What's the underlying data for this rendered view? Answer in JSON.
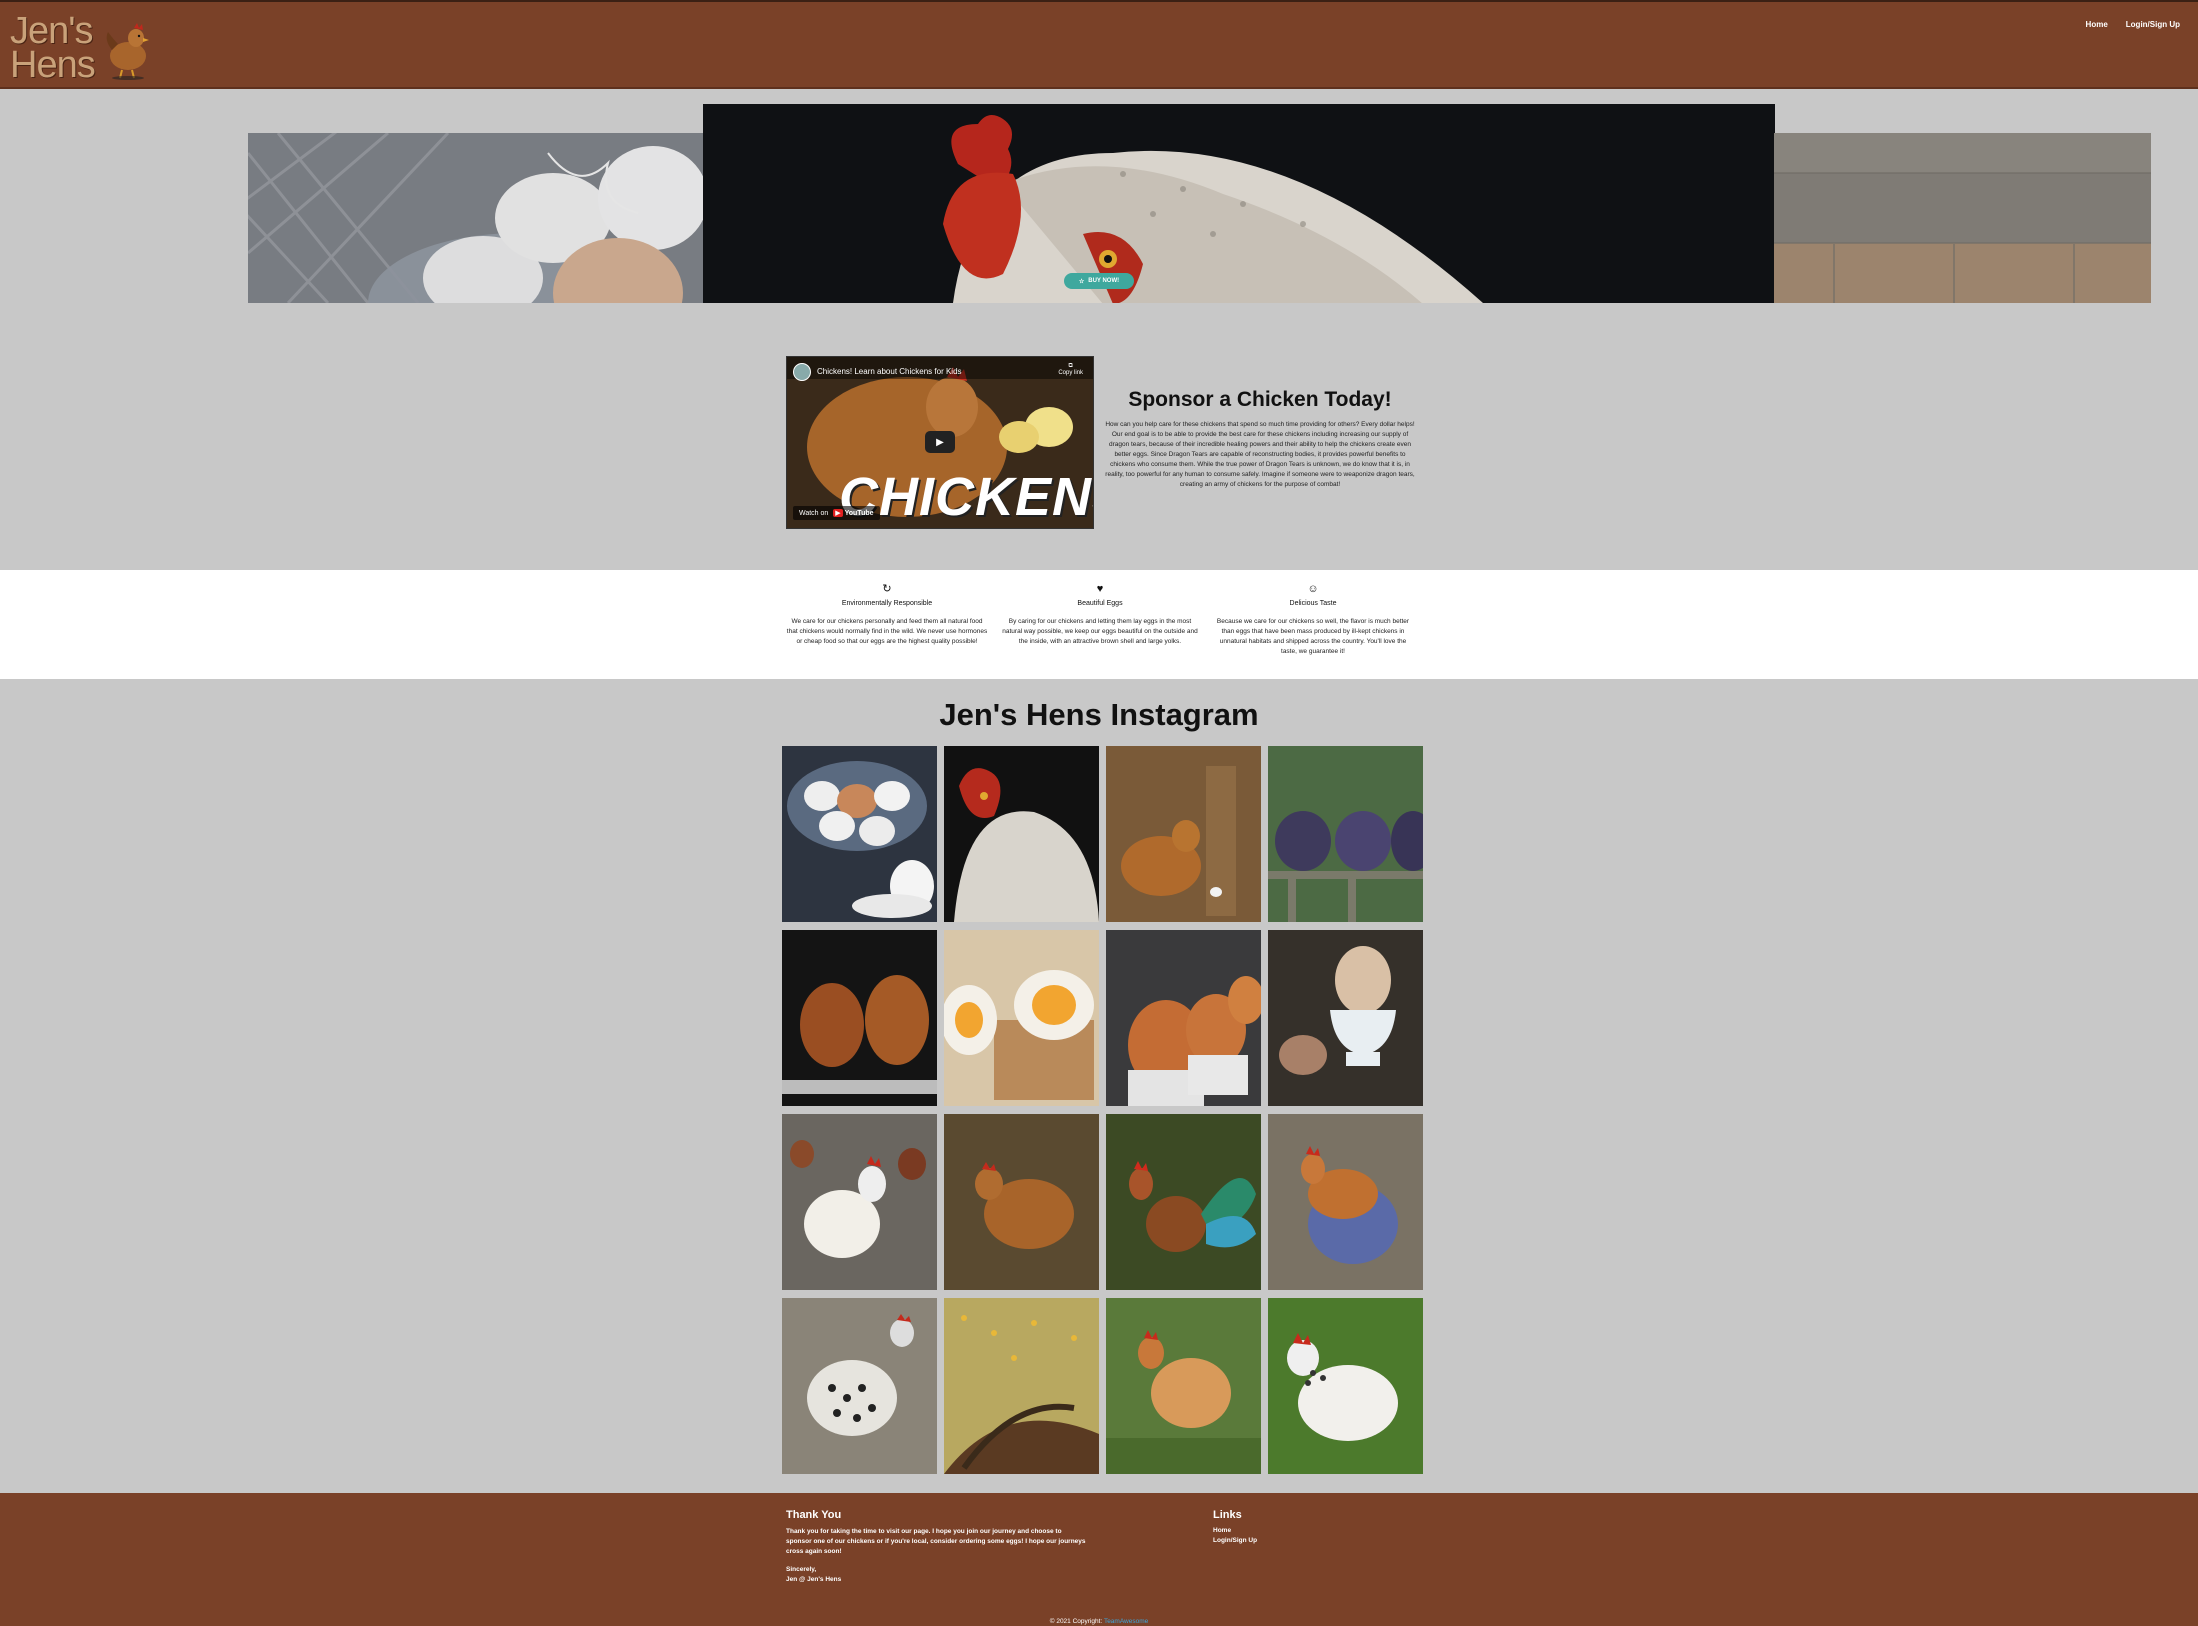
{
  "navbar": {
    "logo_text": "Jen's\nHens",
    "links": [
      {
        "label": "Home"
      },
      {
        "label": "Login/Sign Up"
      }
    ]
  },
  "hero": {
    "buy_button_label": "BUY NOW!"
  },
  "video": {
    "title": "Chickens! Learn about Chickens for Kids",
    "copy_link_label": "Copy link",
    "big_text": "CHICKENS!",
    "watch_on_label": "Watch on",
    "platform_label": "YouTube"
  },
  "sponsor": {
    "title": "Sponsor a Chicken Today!",
    "body": "How can you help care for these chickens that spend so much time providing for others? Every dollar helps! Our end goal is to be able to provide the best care for these chickens including increasing our supply of dragon tears, because of their incredible healing powers and their ability to help the chickens create even better eggs. Since Dragon Tears are capable of reconstructing bodies, it provides powerful benefits to chickens who consume them. While the true power of Dragon Tears is unknown, we do know that it is, in reality, too powerful for any human to consume safely. Imagine if someone were to weaponize dragon tears, creating an army of chickens for the purpose of combat!"
  },
  "features": [
    {
      "icon": "recycle-icon",
      "glyph": "↻",
      "title": "Environmentally Responsible",
      "text": "We care for our chickens personally and feed them all natural food that chickens would normally find in the wild. We never use hormones or cheap food so that our eggs are the highest quality possible!"
    },
    {
      "icon": "heart-icon",
      "glyph": "♥",
      "title": "Beautiful Eggs",
      "text": "By caring for our chickens and letting them lay eggs in the most natural way possible, we keep our eggs beautiful on the outside and the inside, with an attractive brown shell and large yolks."
    },
    {
      "icon": "smile-icon",
      "glyph": "☺",
      "title": "Delicious Taste",
      "text": "Because we care for our chickens so well, the flavor is much better than eggs that have been mass produced by ill-kept chickens in unnatural habitats and shipped across the country. You'll love the taste, we guarantee it!"
    }
  ],
  "instagram": {
    "title": "Jen's Hens Instagram"
  },
  "footer": {
    "thanks_title": "Thank You",
    "thanks_body": "Thank you for taking the time to visit our page. I hope you join our journey and choose to sponsor one of our chickens or if you're local, consider ordering some eggs! I hope our journeys cross again soon!",
    "signoff_1": "Sincerely,",
    "signoff_2": "Jen @ Jen's Hens",
    "links_title": "Links",
    "links": [
      {
        "label": "Home"
      },
      {
        "label": "Login/Sign Up"
      }
    ],
    "copyright_prefix": "© 2021 Copyright:",
    "copyright_link": "TeamAwesome"
  },
  "colors": {
    "brand_brown": "#7a4128",
    "page_gray": "#c8c8c8",
    "accent_teal": "#3fa89e",
    "link_blue": "#3da5d9"
  }
}
